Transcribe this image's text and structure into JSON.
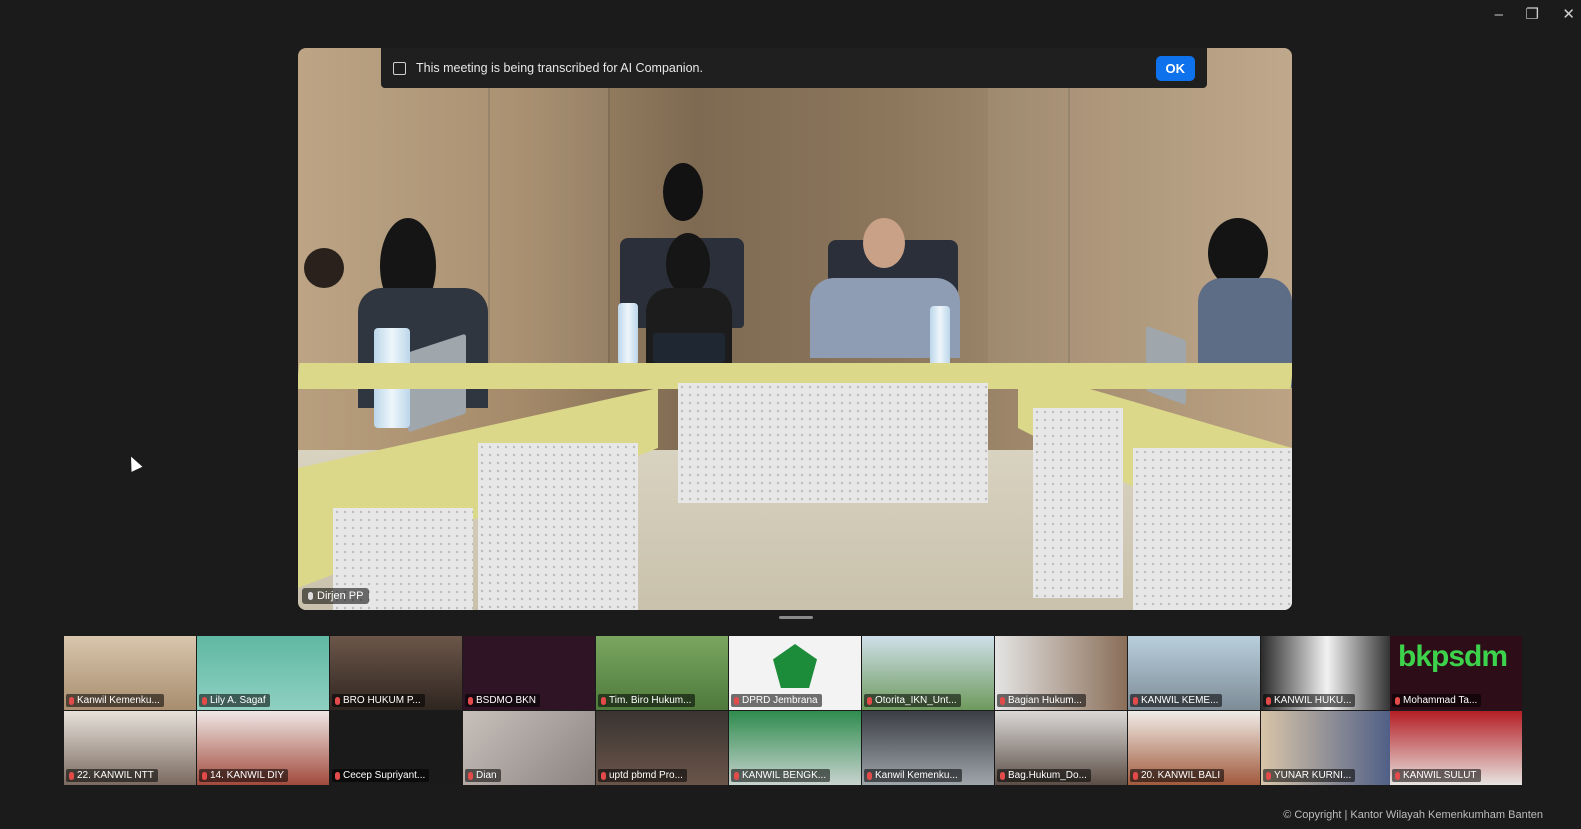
{
  "window": {
    "minimize_icon": "minus-icon",
    "restore_icon": "restore-icon",
    "close_icon": "close-icon",
    "minimize": "–",
    "restore": "❐",
    "close": "✕"
  },
  "banner": {
    "text": "This meeting is being transcribed for AI Companion.",
    "ok_label": "OK",
    "icon": "transcript-icon"
  },
  "main_video": {
    "name": "Dirjen PP",
    "icon": "microphone-icon"
  },
  "gallery": {
    "row1": [
      "Kanwil Kemenku...",
      "Lily A. Sagaf",
      "BRO HUKUM P...",
      "BSDMO BKN",
      "Tim. Biro Hukum...",
      "DPRD Jembrana",
      "Otorita_IKN_Unt...",
      "Bagian Hukum...",
      "KANWIL KEME...",
      "KANWIL HUKU...",
      "Mohammad Ta..."
    ],
    "row2": [
      "22. KANWIL NTT",
      "14. KANWIL DIY",
      "Cecep Supriyant...",
      "Dian",
      "uptd pbmd Pro...",
      "KANWIL BENGK...",
      "Kanwil Kemenku...",
      "Bag.Hukum_Do...",
      "20. KANWIL BALI",
      "YUNAR KURNI...",
      "KANWIL SULUT"
    ],
    "logo_text": "bkpsdm"
  },
  "copyright": "© Copyright | Kantor Wilayah Kemenkumham Banten"
}
